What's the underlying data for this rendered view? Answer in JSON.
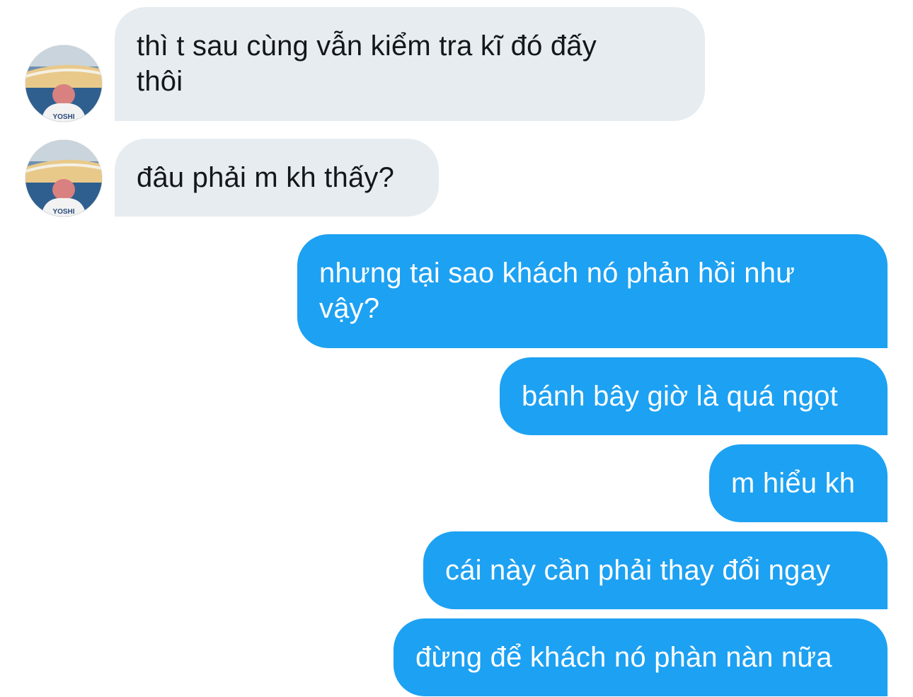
{
  "conversation": {
    "received": [
      {
        "text": "thì t sau cùng vẫn kiểm tra kĩ đó đấy\nthôi"
      },
      {
        "text": "đâu phải m kh thấy?"
      }
    ],
    "sent": [
      {
        "text": "nhưng tại sao khách nó phản hồi như\nvậy?"
      },
      {
        "text": "bánh bây giờ là quá ngọt"
      },
      {
        "text": "m hiểu kh"
      },
      {
        "text": "cái này cần phải thay đổi ngay"
      },
      {
        "text": "đừng để khách nó phàn nàn nữa"
      }
    ]
  },
  "avatar": {
    "jersey_text": "YOSHI",
    "icon": "user-avatar-photo"
  },
  "colors": {
    "received_bubble": "#e6ecf0",
    "sent_bubble": "#1da1f2",
    "received_text": "#14171a",
    "sent_text": "#ffffff"
  }
}
